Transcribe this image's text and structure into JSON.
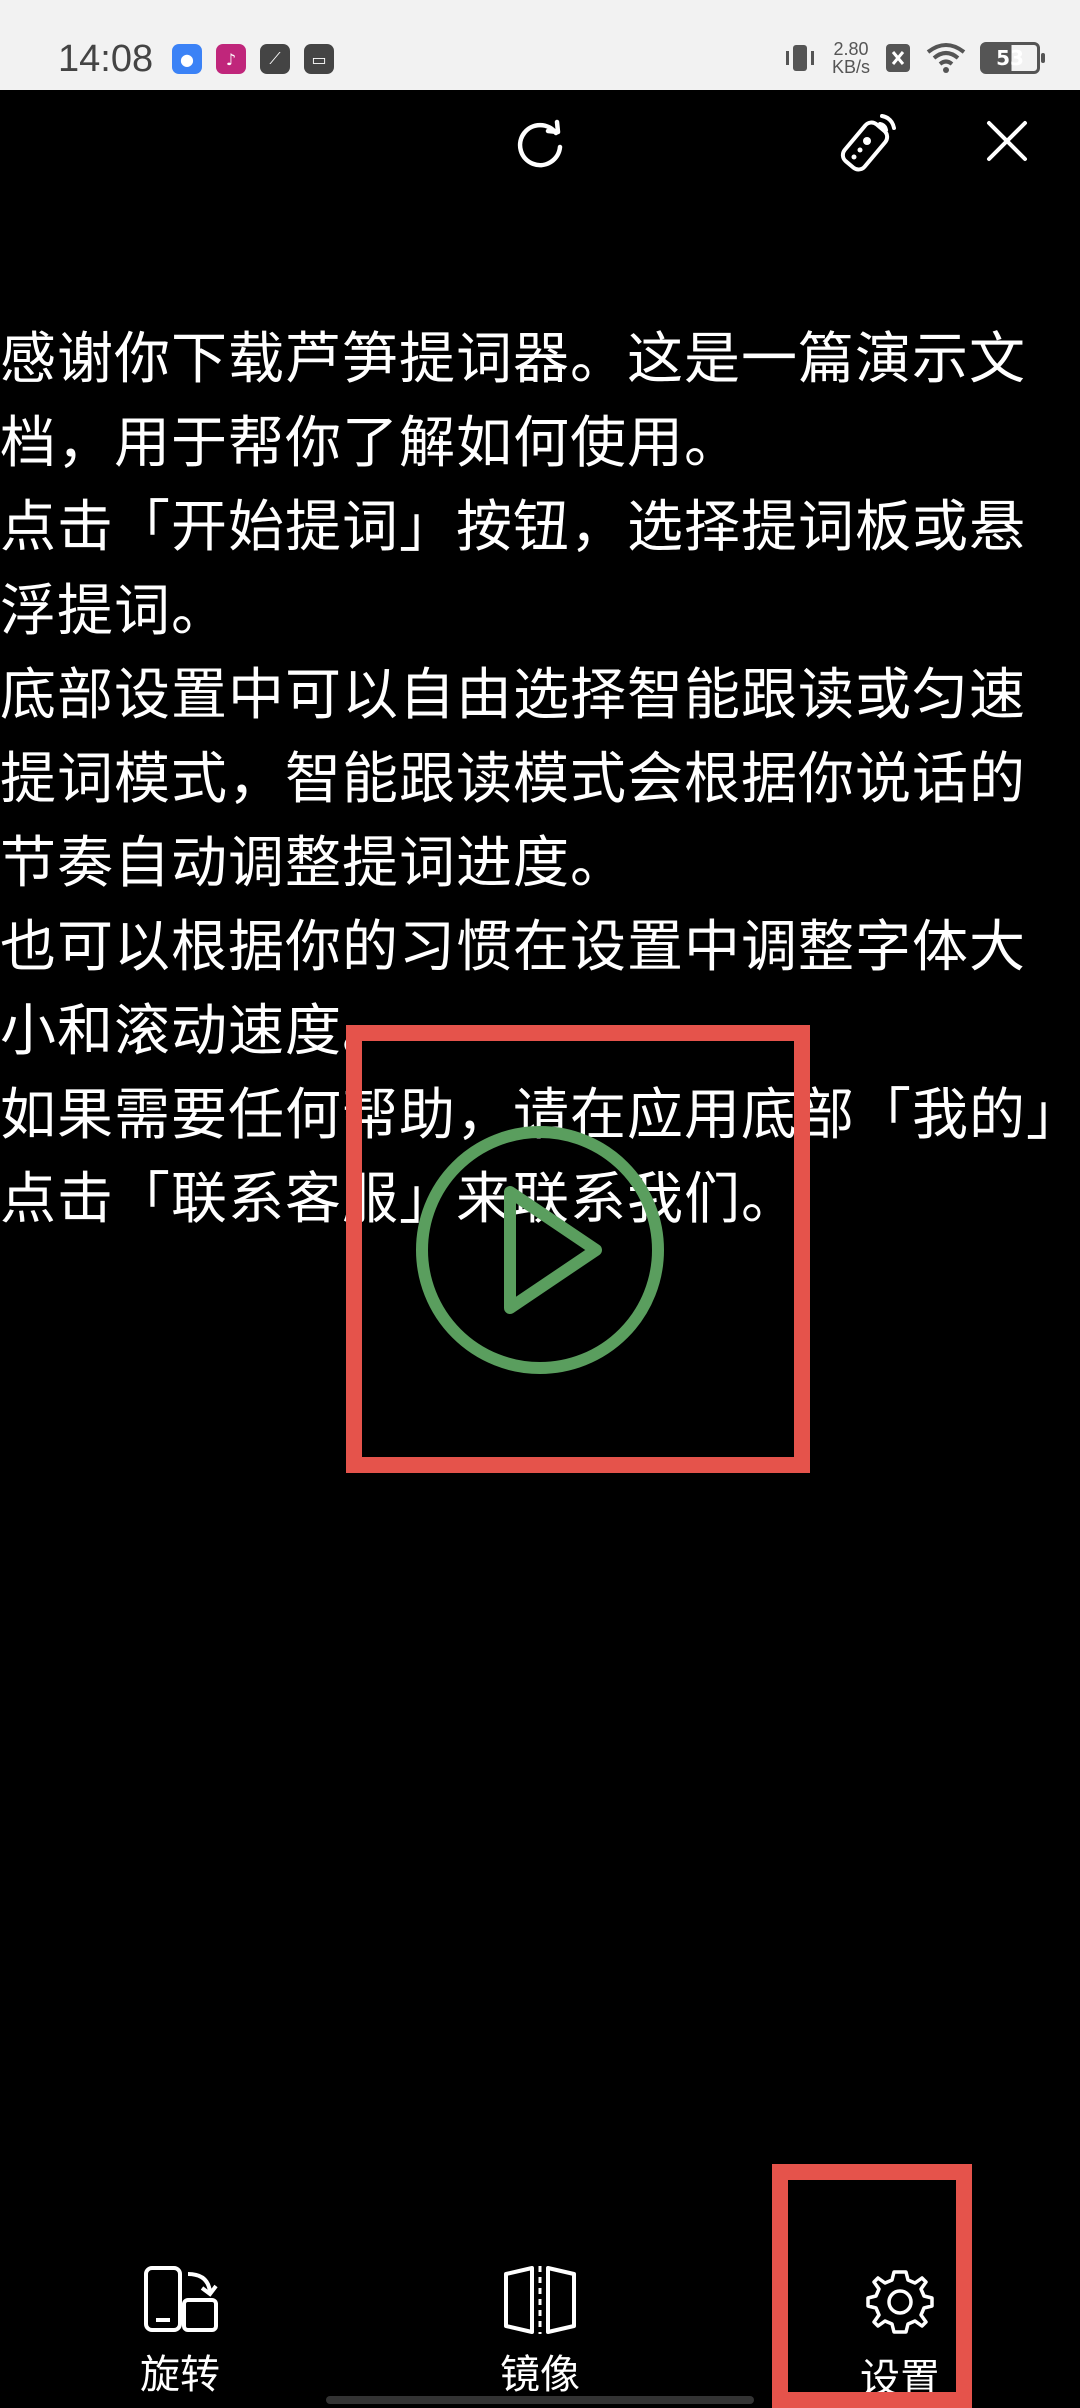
{
  "status_bar": {
    "time": "14:08",
    "net_speed_value": "2.80",
    "net_speed_unit": "KB/s",
    "battery_level": "53",
    "app_icons": [
      "lock-app-icon",
      "pink-app-icon",
      "leaf-app-icon",
      "bag-app-icon"
    ]
  },
  "toolbar": {
    "refresh_icon": "refresh-icon",
    "remote_icon": "remote-control-icon",
    "close_icon": "close-icon"
  },
  "script": {
    "paragraphs": [
      "感谢你下载芦笋提词器。这是一篇演示文档，用于帮你了解如何使用。",
      "点击「开始提词」按钮，选择提词板或悬浮提词。",
      "底部设置中可以自由选择智能跟读或匀速提词模式，智能跟读模式会根据你说话的节奏自动调整提词进度。",
      "也可以根据你的习惯在设置中调整字体大小和滚动速度。",
      "如果需要任何帮助，请在应用底部「我的」点击「联系客服」来联系我们。"
    ]
  },
  "bottom_bar": {
    "rotate_label": "旋转",
    "mirror_label": "镜像",
    "settings_label": "设置"
  },
  "colors": {
    "background": "#000000",
    "text": "#ffffff",
    "play_green": "#5a9e5e",
    "highlight_red": "#e5534b"
  }
}
